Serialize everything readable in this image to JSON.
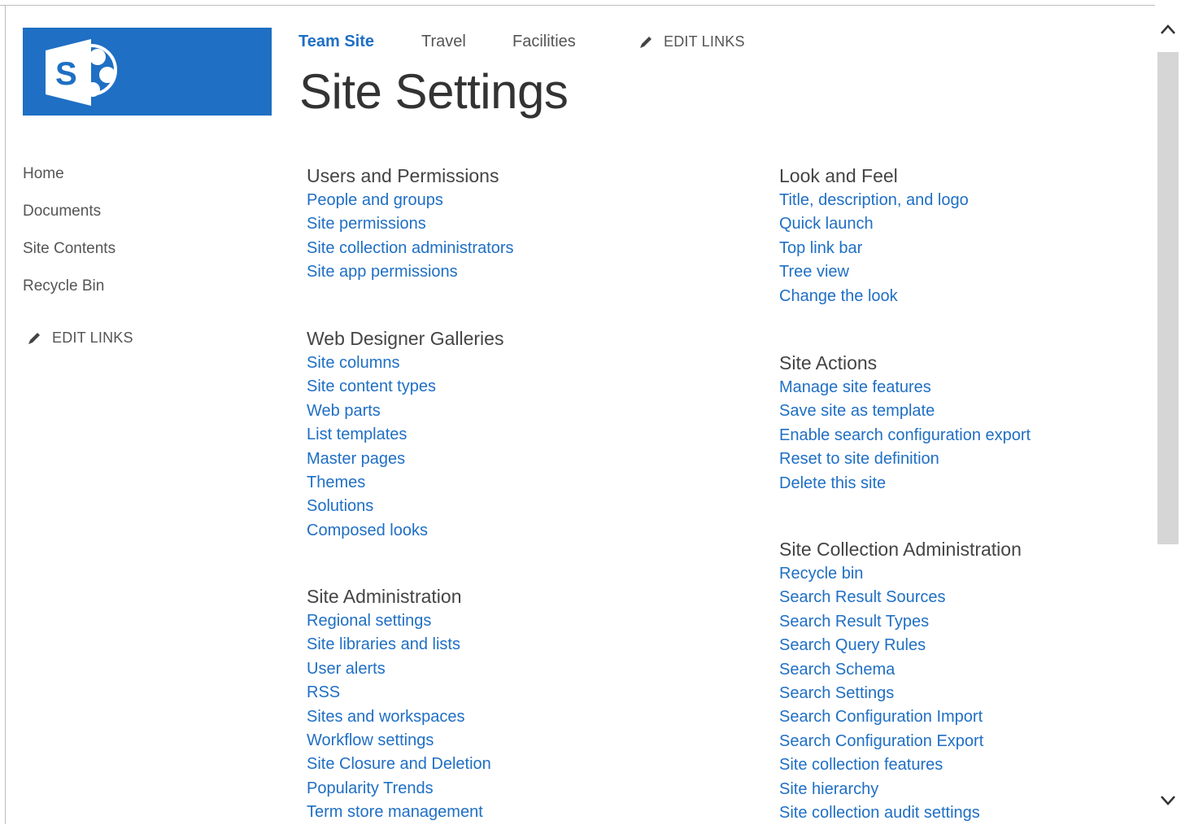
{
  "topnav": {
    "items": [
      {
        "label": "Team Site",
        "selected": true
      },
      {
        "label": "Travel",
        "selected": false
      },
      {
        "label": "Facilities",
        "selected": false
      }
    ],
    "edit_links": "EDIT LINKS"
  },
  "page_title": "Site Settings",
  "logo": {
    "icon": "sharepoint-logo-icon",
    "letter": "S",
    "color": "#1f6fc4"
  },
  "quick_launch": {
    "items": [
      "Home",
      "Documents",
      "Site Contents",
      "Recycle Bin"
    ],
    "edit_links": "EDIT LINKS"
  },
  "sections": {
    "users_permissions": {
      "title": "Users and Permissions",
      "links": [
        "People and groups",
        "Site permissions",
        "Site collection administrators",
        "Site app permissions"
      ]
    },
    "web_designer": {
      "title": "Web Designer Galleries",
      "links": [
        "Site columns",
        "Site content types",
        "Web parts",
        "List templates",
        "Master pages",
        "Themes",
        "Solutions",
        "Composed looks"
      ]
    },
    "site_admin": {
      "title": "Site Administration",
      "links": [
        "Regional settings",
        "Site libraries and lists",
        "User alerts",
        "RSS",
        "Sites and workspaces",
        "Workflow settings",
        "Site Closure and Deletion",
        "Popularity Trends",
        "Term store management"
      ]
    },
    "look_feel": {
      "title": "Look and Feel",
      "links": [
        "Title, description, and logo",
        "Quick launch",
        "Top link bar",
        "Tree view",
        "Change the look"
      ]
    },
    "site_actions": {
      "title": "Site Actions",
      "links": [
        "Manage site features",
        "Save site as template",
        "Enable search configuration export",
        "Reset to site definition",
        "Delete this site"
      ]
    },
    "site_collection_admin": {
      "title": "Site Collection Administration",
      "links": [
        "Recycle bin",
        "Search Result Sources",
        "Search Result Types",
        "Search Query Rules",
        "Search Schema",
        "Search Settings",
        "Search Configuration Import",
        "Search Configuration Export",
        "Site collection features",
        "Site hierarchy",
        "Site collection audit settings"
      ]
    }
  },
  "colors": {
    "link": "#1f6fc4",
    "brand": "#1f6fc4",
    "text": "#444444"
  }
}
